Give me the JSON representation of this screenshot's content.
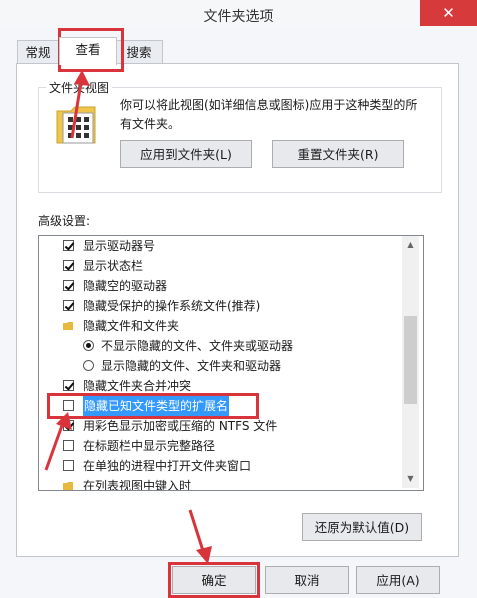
{
  "window": {
    "title": "文件夹选项",
    "close_glyph": "✕"
  },
  "tabs": [
    {
      "label": "常规"
    },
    {
      "label": "查看"
    },
    {
      "label": "搜索"
    }
  ],
  "folder_view": {
    "group_label": "文件夹视图",
    "description": "你可以将此视图(如详细信息或图标)应用于这种类型的所有文件夹。",
    "apply_button": "应用到文件夹(L)",
    "reset_button": "重置文件夹(R)"
  },
  "advanced": {
    "label": "高级设置:",
    "items": [
      {
        "type": "checkbox",
        "checked": true,
        "label": "显示驱动器号"
      },
      {
        "type": "checkbox",
        "checked": true,
        "label": "显示状态栏"
      },
      {
        "type": "checkbox",
        "checked": true,
        "label": "隐藏空的驱动器"
      },
      {
        "type": "checkbox",
        "checked": true,
        "label": "隐藏受保护的操作系统文件(推荐)"
      },
      {
        "type": "folder",
        "label": "隐藏文件和文件夹"
      },
      {
        "type": "radio",
        "checked": true,
        "label": "不显示隐藏的文件、文件夹或驱动器"
      },
      {
        "type": "radio",
        "checked": false,
        "label": "显示隐藏的文件、文件夹和驱动器"
      },
      {
        "type": "checkbox",
        "checked": true,
        "label": "隐藏文件夹合并冲突"
      },
      {
        "type": "checkbox",
        "checked": false,
        "label": "隐藏已知文件类型的扩展名",
        "selected": true
      },
      {
        "type": "checkbox",
        "checked": true,
        "label": "用彩色显示加密或压缩的 NTFS 文件"
      },
      {
        "type": "checkbox",
        "checked": false,
        "label": "在标题栏中显示完整路径"
      },
      {
        "type": "checkbox",
        "checked": false,
        "label": "在单独的进程中打开文件夹窗口"
      },
      {
        "type": "folder",
        "label": "在列表视图中键入时"
      }
    ],
    "restore_button": "还原为默认值(D)"
  },
  "footer": {
    "ok": "确定",
    "cancel": "取消",
    "apply": "应用(A)"
  },
  "colors": {
    "annotation_red": "#d9343c",
    "selection_blue": "#3399ff"
  },
  "icons": {
    "close": "close-icon",
    "folder": "folder-icon",
    "scroll_up": "scroll-up-icon",
    "scroll_down": "scroll-down-icon"
  }
}
